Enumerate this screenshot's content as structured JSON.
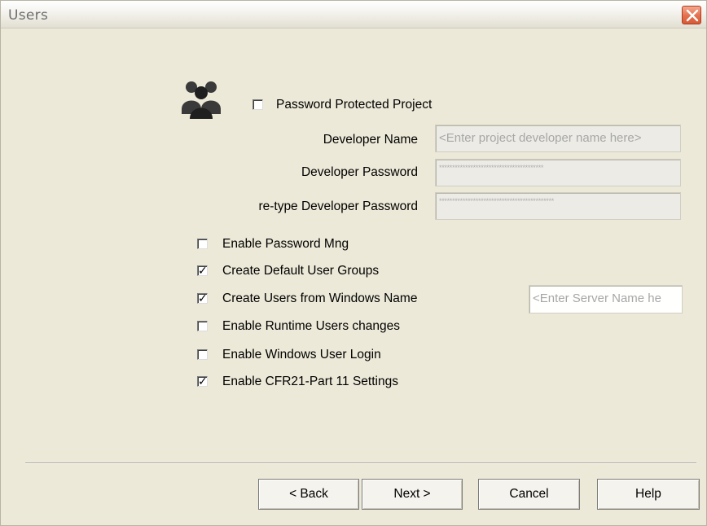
{
  "window": {
    "title": "Users"
  },
  "password_protected": {
    "label": "Password Protected Project",
    "checked": false
  },
  "developer": {
    "name_label": "Developer Name",
    "name_placeholder": "<Enter project developer name here>",
    "password_label": "Developer Password",
    "password_value": "****************************************",
    "retype_label": "re-type Developer Password",
    "retype_value": "********************************************"
  },
  "options": [
    {
      "label": "Enable Password Mng",
      "checked": false
    },
    {
      "label": "Create Default User Groups",
      "checked": true
    },
    {
      "label": "Create Users from Windows Name",
      "checked": true
    },
    {
      "label": "Enable Runtime Users changes",
      "checked": false
    },
    {
      "label": "Enable Windows User Login",
      "checked": false
    },
    {
      "label": "Enable CFR21-Part 11 Settings",
      "checked": true
    }
  ],
  "server": {
    "placeholder": "<Enter Server Name he"
  },
  "buttons": {
    "back": "< Back",
    "next": "Next >",
    "cancel": "Cancel",
    "help": "Help"
  },
  "icons": {
    "users": "users-group-icon",
    "close": "close-icon"
  }
}
